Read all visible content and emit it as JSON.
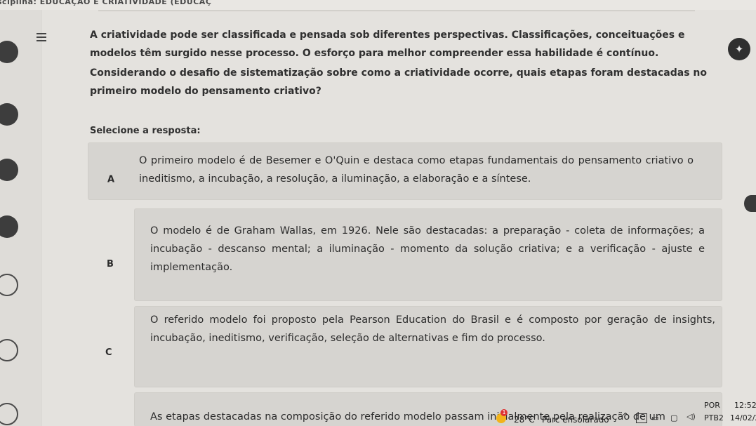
{
  "window": {
    "title": "sciplina: EDUCAÇÃO E CRIATIVIDADE (EDUCAÇ"
  },
  "question": {
    "intro": "A criatividade pode ser classificada e pensada sob diferentes perspectivas. Classificações, conceituações e modelos têm surgido nesse processo. O esforço para melhor compreender essa habilidade é contínuo.",
    "prompt": "Considerando o desafio de sistematização sobre como a criatividade ocorre, quais etapas foram destacadas no primeiro modelo do pensamento criativo?",
    "select_label": "Selecione a resposta:"
  },
  "options": [
    {
      "letter": "A",
      "text": "O primeiro modelo é de Besemer e O'Quin e destaca como etapas fundamentais do pensamento criativo o ineditismo, a incubação, a resolução, a iluminação, a elaboração e a síntese."
    },
    {
      "letter": "B",
      "text": "O modelo é de Graham Wallas, em 1926. Nele são destacadas: a preparação - coleta de informações; a incubação - descanso mental; a iluminação - momento da solução criativa; e a verificação - ajuste e implementação."
    },
    {
      "letter": "C",
      "text": "O referido modelo foi proposto pela Pearson Education do Brasil e é composto por geração de insights, incubação, ineditismo, verificação, seleção de alternativas e fim do processo."
    },
    {
      "letter": "D",
      "text": "As etapas destacadas na composição do referido modelo passam inicialmente pela realização de um"
    }
  ],
  "taskbar": {
    "weather_temp": "28°C",
    "weather_desc": "Parc ensolarado",
    "notification_count": "1",
    "lang_top": "POR",
    "lang_bottom": "PTB2",
    "time": "12:52",
    "date": "14/02/2"
  },
  "icons": [
    "menu-icon",
    "chat-bubble-icon",
    "weather-sun-icon",
    "chevron-up-icon",
    "network-icon",
    "speaker-icon"
  ]
}
